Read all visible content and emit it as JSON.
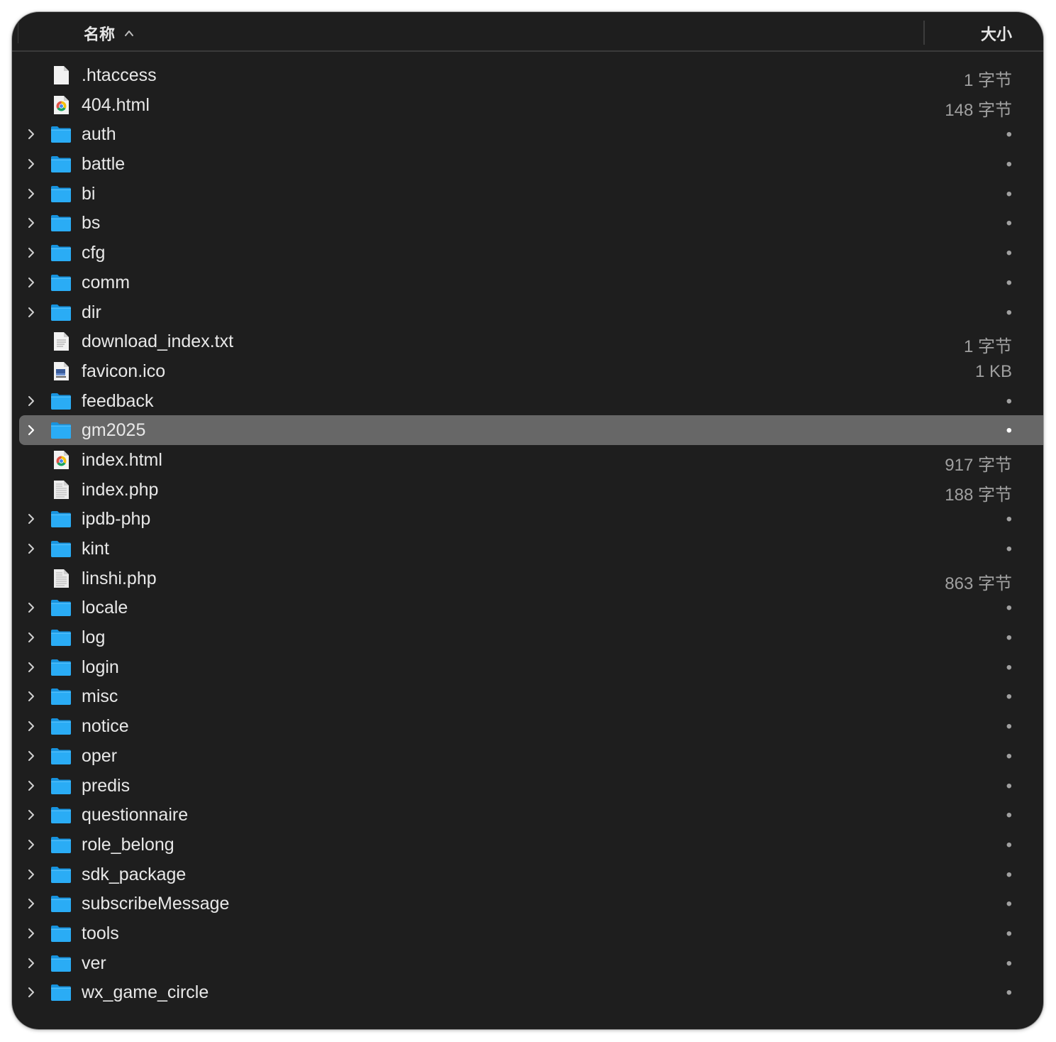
{
  "header": {
    "name_label": "名称",
    "size_label": "大小"
  },
  "rows": [
    {
      "name": ".htaccess",
      "size": "1 字节",
      "kind": "file",
      "expandable": false
    },
    {
      "name": "404.html",
      "size": "148 字节",
      "kind": "chrome-html",
      "expandable": false
    },
    {
      "name": "auth",
      "size": "•",
      "kind": "folder",
      "expandable": true
    },
    {
      "name": "battle",
      "size": "•",
      "kind": "folder",
      "expandable": true
    },
    {
      "name": "bi",
      "size": "•",
      "kind": "folder",
      "expandable": true
    },
    {
      "name": "bs",
      "size": "•",
      "kind": "folder",
      "expandable": true
    },
    {
      "name": "cfg",
      "size": "•",
      "kind": "folder",
      "expandable": true
    },
    {
      "name": "comm",
      "size": "•",
      "kind": "folder",
      "expandable": true
    },
    {
      "name": "dir",
      "size": "•",
      "kind": "folder",
      "expandable": true
    },
    {
      "name": "download_index.txt",
      "size": "1 字节",
      "kind": "text",
      "expandable": false
    },
    {
      "name": "favicon.ico",
      "size": "1 KB",
      "kind": "image",
      "expandable": false
    },
    {
      "name": "feedback",
      "size": "•",
      "kind": "folder",
      "expandable": true
    },
    {
      "name": "gm2025",
      "size": "•",
      "kind": "folder",
      "expandable": true,
      "selected": true
    },
    {
      "name": "index.html",
      "size": "917 字节",
      "kind": "chrome-html",
      "expandable": false
    },
    {
      "name": "index.php",
      "size": "188 字节",
      "kind": "code",
      "expandable": false
    },
    {
      "name": "ipdb-php",
      "size": "•",
      "kind": "folder",
      "expandable": true
    },
    {
      "name": "kint",
      "size": "•",
      "kind": "folder",
      "expandable": true
    },
    {
      "name": "linshi.php",
      "size": "863 字节",
      "kind": "code",
      "expandable": false
    },
    {
      "name": "locale",
      "size": "•",
      "kind": "folder",
      "expandable": true
    },
    {
      "name": "log",
      "size": "•",
      "kind": "folder",
      "expandable": true
    },
    {
      "name": "login",
      "size": "•",
      "kind": "folder",
      "expandable": true
    },
    {
      "name": "misc",
      "size": "•",
      "kind": "folder",
      "expandable": true
    },
    {
      "name": "notice",
      "size": "•",
      "kind": "folder",
      "expandable": true
    },
    {
      "name": "oper",
      "size": "•",
      "kind": "folder",
      "expandable": true
    },
    {
      "name": "predis",
      "size": "•",
      "kind": "folder",
      "expandable": true
    },
    {
      "name": "questionnaire",
      "size": "•",
      "kind": "folder",
      "expandable": true
    },
    {
      "name": "role_belong",
      "size": "•",
      "kind": "folder",
      "expandable": true
    },
    {
      "name": "sdk_package",
      "size": "•",
      "kind": "folder",
      "expandable": true
    },
    {
      "name": "subscribeMessage",
      "size": "•",
      "kind": "folder",
      "expandable": true
    },
    {
      "name": "tools",
      "size": "•",
      "kind": "folder",
      "expandable": true
    },
    {
      "name": "ver",
      "size": "•",
      "kind": "folder",
      "expandable": true
    },
    {
      "name": "wx_game_circle",
      "size": "•",
      "kind": "folder",
      "expandable": true
    }
  ],
  "colors": {
    "window_bg": "#1e1e1e",
    "selection": "#676767",
    "folder_blue": "#1ba1f2",
    "text": "#e8e8e8",
    "size_text": "#a0a0a0"
  }
}
